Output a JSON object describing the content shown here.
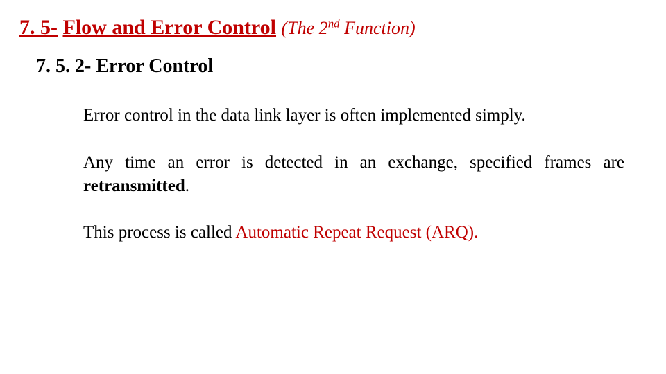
{
  "heading": {
    "number": "7. 5",
    "title": "Flow and Error Control",
    "note_prefix": "(The 2",
    "note_sup": "nd",
    "note_suffix": " Function)"
  },
  "subheading": {
    "number": "7. 5. 2",
    "title": "Error Control"
  },
  "paragraphs": {
    "p1": "Error control in the data link layer is often implemented simply.",
    "p2_prefix": "Any time an error is detected in an exchange, specified frames are ",
    "p2_bold": "retransmitted",
    "p2_suffix": ".",
    "p3_prefix": "This process is called ",
    "p3_red": "Automatic Repeat Request (ARQ)."
  }
}
